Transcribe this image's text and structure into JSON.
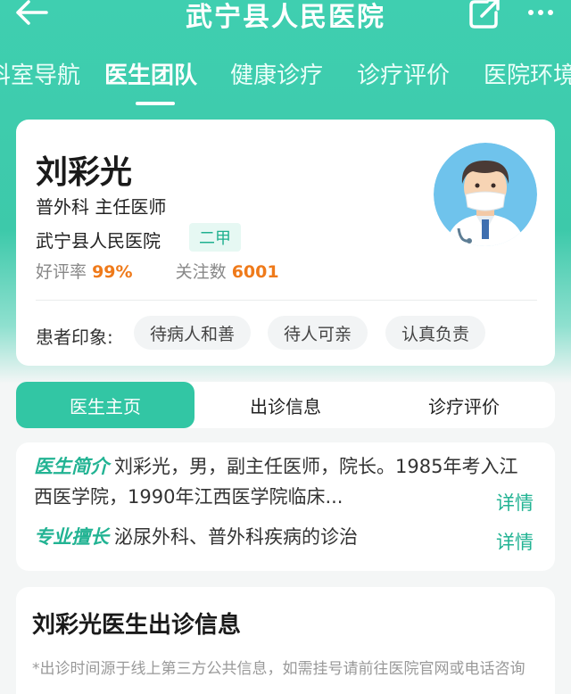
{
  "header": {
    "title": "武宁县人民医院",
    "back_icon": "arrow-left-icon",
    "share_icon": "share-icon",
    "more_icon": "more-dots-icon"
  },
  "tabs": [
    {
      "label": "科室导航"
    },
    {
      "label": "医生团队",
      "active": true
    },
    {
      "label": "健康诊疗"
    },
    {
      "label": "诊疗评价"
    },
    {
      "label": "医院环境"
    }
  ],
  "doctor": {
    "name": "刘彩光",
    "dept_title": "普外科 主任医师",
    "hospital": "武宁县人民医院",
    "grade": "二甲",
    "rating_label": "好评率",
    "rating_value": "99%",
    "follow_label": "关注数",
    "follow_value": "6001",
    "impression_label": "患者印象:",
    "impressions": [
      "待病人和善",
      "待人可亲",
      "认真负责"
    ]
  },
  "segments": [
    {
      "label": "医生主页",
      "active": true
    },
    {
      "label": "出诊信息"
    },
    {
      "label": "诊疗评价"
    }
  ],
  "intro": {
    "label": "医生简介",
    "text": "刘彩光，男，副主任医师，院长。1985年考入江西医学院，1990年江西医学院临床...",
    "detail": "详情"
  },
  "specialty": {
    "label": "专业擅长",
    "text": "泌尿外科、普外科疾病的诊治",
    "detail": "详情"
  },
  "schedule": {
    "title": "刘彩光医生出诊信息",
    "note": "*出诊时间源于线上第三方公共信息，如需挂号请前往医院官网或电话咨询"
  },
  "colors": {
    "accent": "#32c6a4",
    "accent_text": "#22b393",
    "highlight": "#ef7a1a"
  }
}
